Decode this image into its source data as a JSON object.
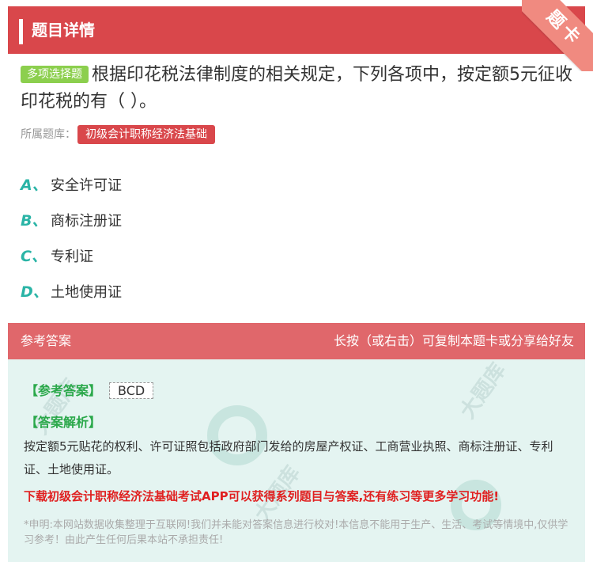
{
  "header": {
    "title": "题目详情"
  },
  "corner_badge": {
    "label": "题卡"
  },
  "question": {
    "type_tag": "多项选择题",
    "text": "根据印花税法律制度的相关规定，下列各项中，按定额5元征收印花税的有（   ）。"
  },
  "bank": {
    "label": "所属题库：",
    "name": "初级会计职称经济法基础"
  },
  "options": [
    {
      "letter": "A、",
      "text": "安全许可证"
    },
    {
      "letter": "B、",
      "text": "商标注册证"
    },
    {
      "letter": "C、",
      "text": "专利证"
    },
    {
      "letter": "D、",
      "text": "土地使用证"
    }
  ],
  "answer_section": {
    "title": "参考答案",
    "hint": "长按（或右击）可复制本题卡或分享给好友"
  },
  "answer": {
    "label": "【参考答案】",
    "value": "BCD",
    "analysis_label": "【答案解析】",
    "analysis_text": "按定额5元贴花的权利、许可证照包括政府部门发给的房屋产权证、工商营业执照、商标注册证、专利证、土地使用证。",
    "promo": "下载初级会计职称经济法基础考试APP可以获得系列题目与答案,还有练习等更多学习功能!",
    "disclaimer": "*申明:本网站数据收集整理于互联网!我们并未能对答案信息进行校对!本信息不能用于生产、生活、考试等情境中,仅供学习参考！由此产生任何后果本站不承担责任!"
  },
  "colors": {
    "header_red": "#d9474b",
    "answer_head": "#e0676b",
    "answer_bg": "#e4f4f1",
    "option_letter": "#2ab4a6",
    "type_tag": "#8ccf4e",
    "promo_red": "#e02020"
  }
}
